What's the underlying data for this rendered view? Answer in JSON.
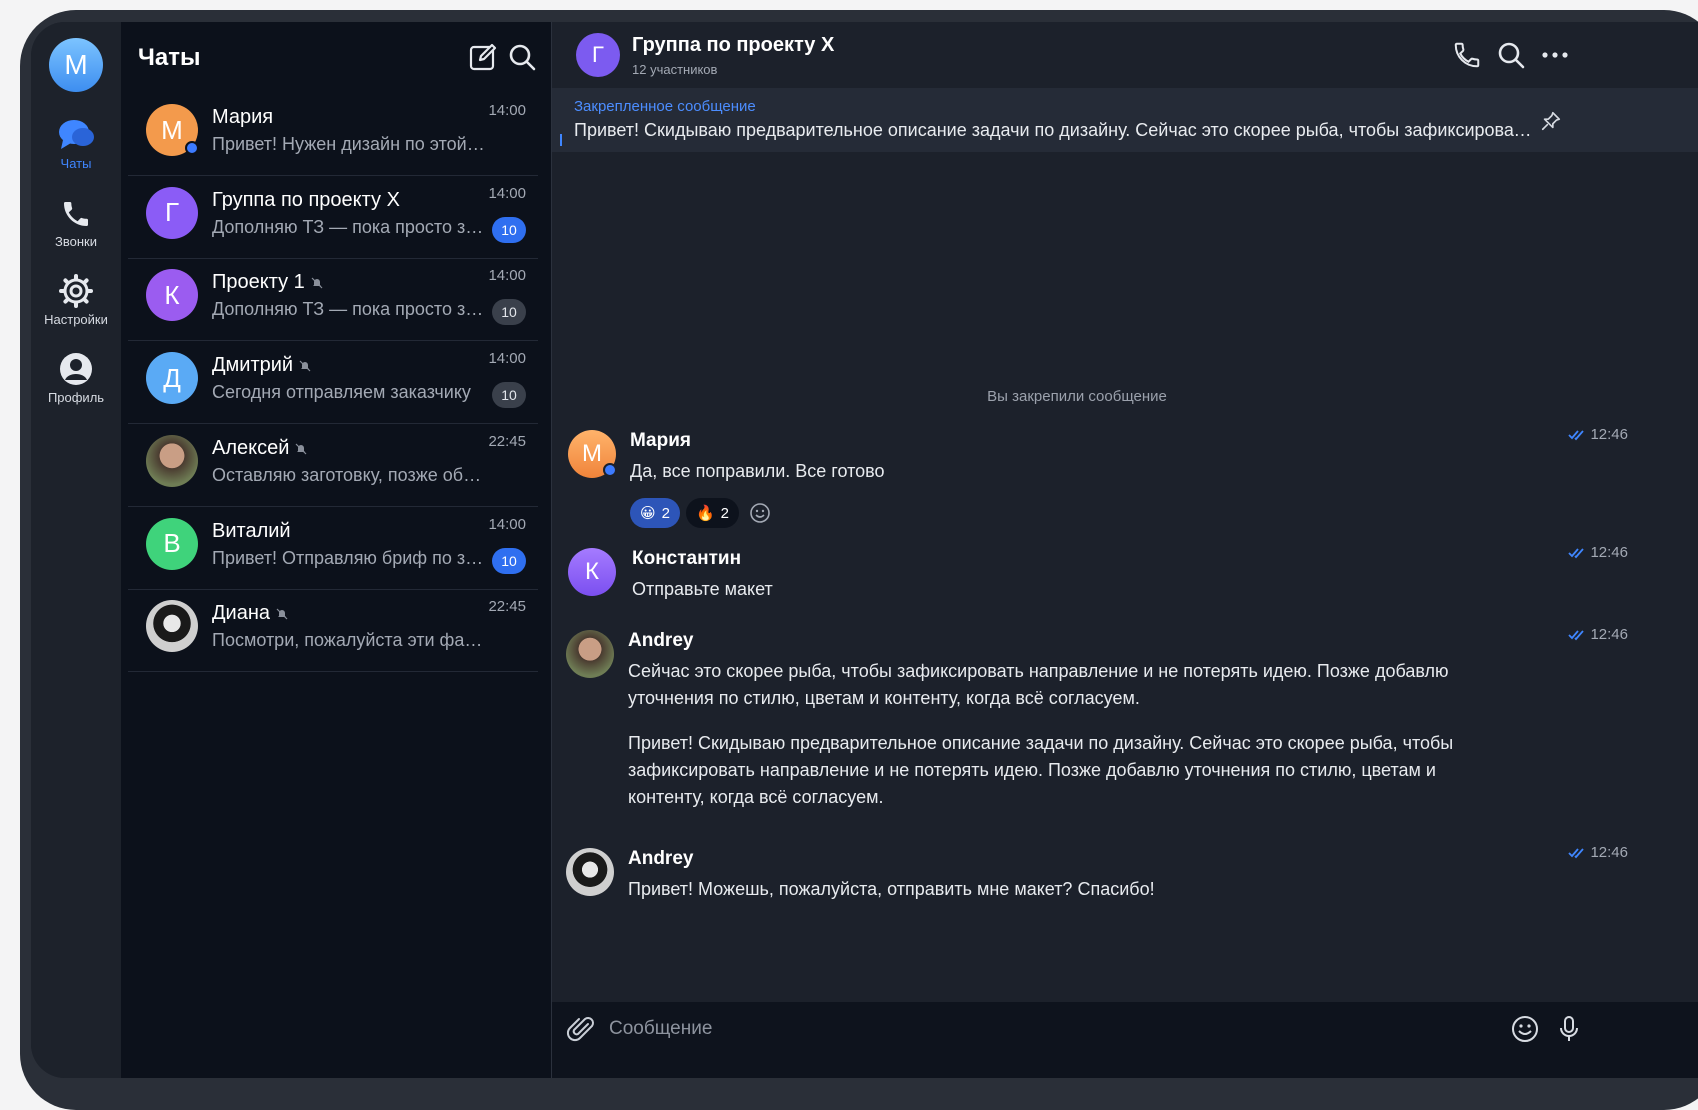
{
  "sidebar": {
    "me_initial": "М",
    "items": [
      {
        "label": "Чаты",
        "icon": "chat-bubbles-icon",
        "active": true
      },
      {
        "label": "Звонки",
        "icon": "phone-icon"
      },
      {
        "label": "Настройки",
        "icon": "gear-icon"
      },
      {
        "label": "Профиль",
        "icon": "user-icon"
      }
    ]
  },
  "chat_list": {
    "title": "Чаты",
    "chats": [
      {
        "name": "Мария",
        "initial": "М",
        "preview": "Привет! Нужен дизайн по этой задаче",
        "time": "14:00",
        "badge": "",
        "color": "#f39a4c",
        "online": true
      },
      {
        "name": "Группа по проекту Х",
        "initial": "Г",
        "preview": "Дополняю ТЗ — пока просто заметки",
        "time": "14:00",
        "badge": "10",
        "badge_style": "blue",
        "color": "#8b5cf6"
      },
      {
        "name": "Проекту 1",
        "initial": "К",
        "preview": "Дополняю ТЗ — пока просто заметки",
        "time": "14:00",
        "badge": "10",
        "badge_style": "gray",
        "color": "#9b5cf0",
        "muted": true
      },
      {
        "name": "Дмитрий",
        "initial": "Д",
        "preview": "Сегодня отправляем заказчику",
        "time": "14:00",
        "badge": "10",
        "badge_style": "gray",
        "color": "#5aaaf5",
        "muted": true
      },
      {
        "name": "Алексей",
        "initial": "",
        "preview": "Оставляю заготовку, позже обновлю",
        "time": "22:45",
        "badge": "",
        "photo": true,
        "muted": true
      },
      {
        "name": "Виталий",
        "initial": "В",
        "preview": "Привет! Отправляю бриф по задаче",
        "time": "14:00",
        "badge": "10",
        "badge_style": "blue",
        "color": "#3fd37b"
      },
      {
        "name": "Диана",
        "initial": "",
        "preview": "Посмотри, пожалуйста эти файлы",
        "time": "22:45",
        "badge": "",
        "photo": true,
        "muted": true
      }
    ]
  },
  "conversation": {
    "title": "Группа по проекту Х",
    "subtitle": "12 участников",
    "initial": "Г",
    "pinned_title": "Закрепленное сообщение",
    "pinned_text": "Привет! Скидываю предварительное описание задачи по дизайну. Сейчас это скорее рыба, чтобы зафиксировать направление и не потерять идею",
    "system_note": "Вы закрепили сообщение",
    "messages": [
      {
        "author": "Мария",
        "initial": "М",
        "text": "Да, все поправили. Все готово",
        "time": "12:46",
        "reactions": [
          {
            "emoji": "😀",
            "count": "2"
          },
          {
            "emoji": "🔥",
            "count": "2"
          }
        ]
      },
      {
        "author": "Константин",
        "initial": "К",
        "text": "Отправьте макет",
        "time": "12:46"
      },
      {
        "author": "Andrey",
        "text": "Сейчас это скорее рыба, чтобы зафиксировать направление и не потерять идею. Позже добавлю уточнения по стилю, цветам и контенту, когда всё согласуем.",
        "text2": "Привет! Скидываю предварительное описание задачи по дизайну. Сейчас это скорее рыба, чтобы зафиксировать направление и не потерять идею. Позже добавлю уточнения по стилю, цветам и контенту, когда всё согласуем.",
        "time": "12:46"
      },
      {
        "author": "Andrey",
        "text": "Привет! Можешь, пожалуйста, отправить мне макет? Спасибо!",
        "time": "12:46"
      }
    ]
  },
  "composer": {
    "placeholder": "Сообщение"
  },
  "colors": {
    "accent": "#3f86ff",
    "panel": "#0c111b",
    "main": "#1c212b"
  }
}
